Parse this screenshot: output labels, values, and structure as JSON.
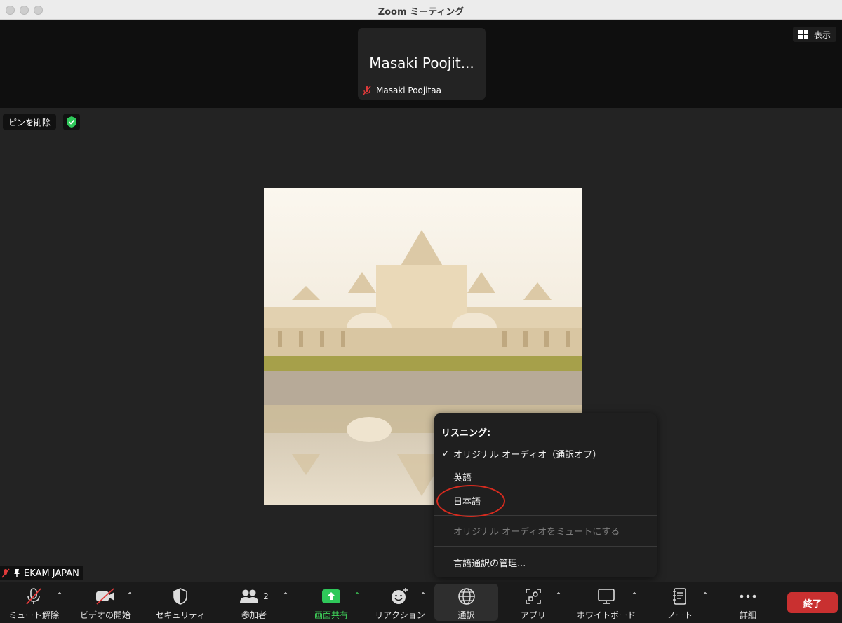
{
  "window": {
    "title": "Zoom ミーティング"
  },
  "top_strip": {
    "participant_big_name": "Masaki Poojit...",
    "participant_name": "Masaki Poojitaa",
    "view_label": "表示"
  },
  "pin": {
    "unpin_label": "ピンを削除"
  },
  "speaker": {
    "name": "EKAM JAPAN"
  },
  "popup": {
    "header": "リスニング:",
    "items": [
      {
        "label": "オリジナル オーディオ（通訳オフ）",
        "checked": true
      },
      {
        "label": "英語"
      },
      {
        "label": "日本語"
      }
    ],
    "mute_original": "オリジナル オーディオをミュートにする",
    "manage": "言語通訳の管理..."
  },
  "toolbar": {
    "unmute": "ミュート解除",
    "start_video": "ビデオの開始",
    "security": "セキュリティ",
    "participants": "参加者",
    "participants_count": "2",
    "share_screen": "画面共有",
    "reactions": "リアクション",
    "interpretation": "通訳",
    "apps": "アプリ",
    "whiteboard": "ホワイトボード",
    "notes": "ノート",
    "more": "詳細",
    "end": "終了"
  },
  "colors": {
    "end_red": "#c93030",
    "share_green": "#3fd35a",
    "annotation_red": "#d62b1f"
  }
}
